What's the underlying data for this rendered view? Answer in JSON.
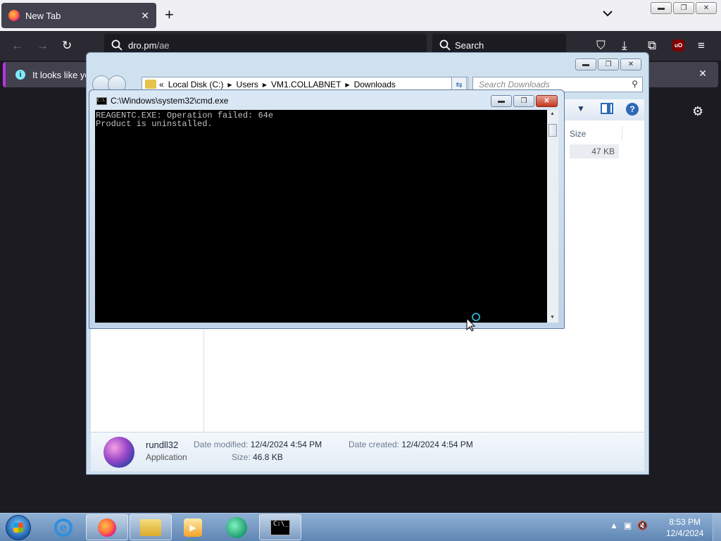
{
  "browser": {
    "tab_title": "New Tab",
    "tab_close": "✕",
    "new_tab": "+",
    "list_all_tabs": "⌄",
    "url_host": "dro.pm",
    "url_path": "/ae",
    "search_placeholder": "Search",
    "ublock_label": "uO",
    "infobar_text": "It looks like you",
    "infobar_close": "✕",
    "nav_icons": {
      "back": "←",
      "forward": "→",
      "reload": "↻",
      "pocket": "⛉",
      "downloads": "⤓",
      "extensions": "⧉",
      "menu": "≡",
      "settings": "⚙"
    }
  },
  "explorer": {
    "address": [
      "Local Disk (C:)",
      "Users",
      "VM1.COLLABNET",
      "Downloads"
    ],
    "address_prefix": "«",
    "search_placeholder": "Search Downloads",
    "column_size": "Size",
    "file_size_cell": "47 KB",
    "details": {
      "name": "rundll32",
      "type": "Application",
      "date_modified_label": "Date modified:",
      "date_modified": "12/4/2024 4:54 PM",
      "date_created_label": "Date created:",
      "date_created": "12/4/2024 4:54 PM",
      "size_label": "Size:",
      "size": "46.8 KB"
    }
  },
  "cmd": {
    "title": "C:\\Windows\\system32\\cmd.exe",
    "lines": [
      "REAGENTC.EXE: Operation failed: 64e",
      "Product is uninstalled."
    ]
  },
  "taskbar": {
    "time": "8:53 PM",
    "date": "12/4/2024",
    "pinned": [
      "internet-explorer",
      "firefox",
      "windows-explorer",
      "media-player",
      "green-app",
      "command-prompt"
    ],
    "tray_expand": "▲"
  },
  "colors": {
    "firefox_dark": "#2b2a33",
    "infobar_accent": "#b833e1",
    "taskbar_blue": "#5f86b4",
    "console_bg": "#000000"
  }
}
